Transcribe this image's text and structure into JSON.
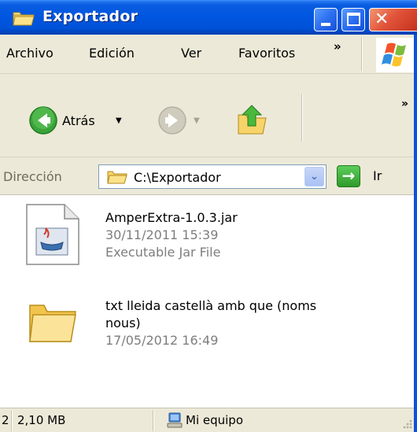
{
  "window": {
    "title": "Exportador",
    "title_icon": "folder-icon",
    "controls": [
      "minimize-icon",
      "maximize-icon",
      "close-icon"
    ],
    "close_glyph": "✕"
  },
  "menu": {
    "items": [
      "Archivo",
      "Edición",
      "Ver",
      "Favoritos"
    ],
    "overflow": "»"
  },
  "toolbar": {
    "back_label": "Atrás",
    "back_dropdown": "▼",
    "forward_dropdown": "▼",
    "overflow": "»"
  },
  "address": {
    "label": "Dirección",
    "path": "C:\\Exportador",
    "dropdown": "⌄",
    "go_arrow": "→",
    "go_label": "Ir"
  },
  "files": [
    {
      "name": "AmperExtra-1.0.3.jar",
      "date": "30/11/2011 15:39",
      "type": "Executable Jar File",
      "icon": "jar-file-icon"
    },
    {
      "name_line1": "txt lleida castellà amb que (noms",
      "name_line2": "nous)",
      "date": "17/05/2012 16:49",
      "icon": "folder-icon"
    }
  ],
  "status": {
    "count": "2",
    "size": "2,10 MB",
    "location": "Mi equipo"
  },
  "colors": {
    "titlebar": "#0056e0",
    "chrome": "#ece9d8",
    "meta_text": "#7e7e7e"
  }
}
